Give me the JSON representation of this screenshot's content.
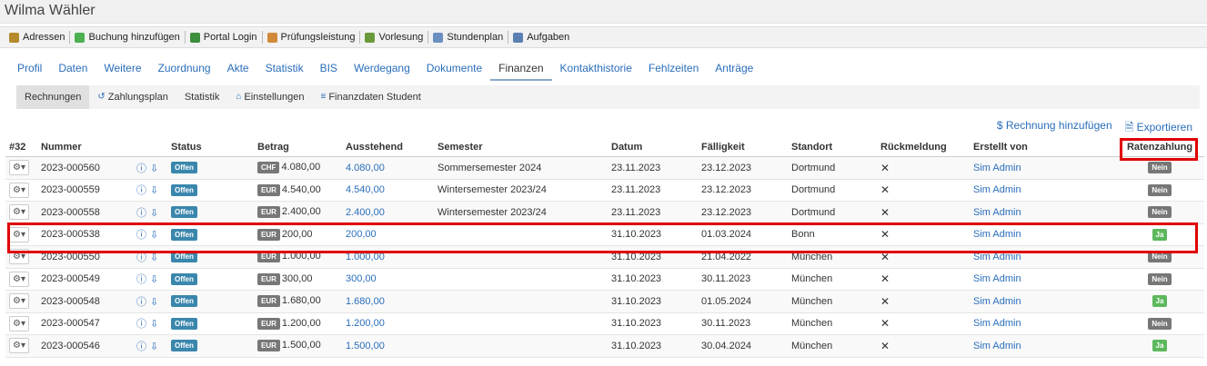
{
  "header": {
    "title": "Wilma Wähler"
  },
  "toolbar": {
    "items": [
      {
        "label": "Adressen",
        "icon": "address-book-icon",
        "color": "#b58a2a"
      },
      {
        "label": "Buchung hinzufügen",
        "icon": "add-booking-icon",
        "color": "#4caf50"
      },
      {
        "label": "Portal Login",
        "icon": "globe-icon",
        "color": "#3c8f3c"
      },
      {
        "label": "Prüfungsleistung",
        "icon": "exam-icon",
        "color": "#d08a3a"
      },
      {
        "label": "Vorlesung",
        "icon": "lecture-icon",
        "color": "#6a9a3a"
      },
      {
        "label": "Stundenplan",
        "icon": "calendar-icon",
        "color": "#6b8fc0"
      },
      {
        "label": "Aufgaben",
        "icon": "tasks-icon",
        "color": "#5b7fb0"
      }
    ]
  },
  "tabs": [
    {
      "label": "Profil"
    },
    {
      "label": "Daten"
    },
    {
      "label": "Weitere"
    },
    {
      "label": "Zuordnung"
    },
    {
      "label": "Akte"
    },
    {
      "label": "Statistik"
    },
    {
      "label": "BIS"
    },
    {
      "label": "Werdegang"
    },
    {
      "label": "Dokumente"
    },
    {
      "label": "Finanzen",
      "active": true
    },
    {
      "label": "Kontakthistorie"
    },
    {
      "label": "Fehlzeiten"
    },
    {
      "label": "Anträge"
    }
  ],
  "subtabs": [
    {
      "label": "Rechnungen",
      "icon": "",
      "active": true
    },
    {
      "label": "Zahlungsplan",
      "icon": "↺"
    },
    {
      "label": "Statistik",
      "icon": ""
    },
    {
      "label": "Einstellungen",
      "icon": "⌂"
    },
    {
      "label": "Finanzdaten Student",
      "icon": "≡"
    }
  ],
  "actions": {
    "add_invoice": "$ Rechnung hinzufügen",
    "export": "🗎 Exportieren"
  },
  "table": {
    "columns": [
      "#32",
      "Nummer",
      "",
      "Status",
      "Betrag",
      "Ausstehend",
      "Semester",
      "Datum",
      "Fälligkeit",
      "Standort",
      "Rückmeldung",
      "Erstellt von",
      "Ratenzahlung"
    ],
    "rows": [
      {
        "nummer": "2023-000560",
        "status": "Offen",
        "currency": "CHF",
        "betrag": "4.080,00",
        "ausstehend": "4.080,00",
        "semester": "Sommersemester 2024",
        "datum": "23.11.2023",
        "faelligkeit": "23.12.2023",
        "standort": "Dortmund",
        "rueckmeldung": "✕",
        "erstellt": "Sim Admin",
        "rate": "Nein"
      },
      {
        "nummer": "2023-000559",
        "status": "Offen",
        "currency": "EUR",
        "betrag": "4.540,00",
        "ausstehend": "4.540,00",
        "semester": "Wintersemester 2023/24",
        "datum": "23.11.2023",
        "faelligkeit": "23.12.2023",
        "standort": "Dortmund",
        "rueckmeldung": "✕",
        "erstellt": "Sim Admin",
        "rate": "Nein"
      },
      {
        "nummer": "2023-000558",
        "status": "Offen",
        "currency": "EUR",
        "betrag": "2.400,00",
        "ausstehend": "2.400,00",
        "semester": "Wintersemester 2023/24",
        "datum": "23.11.2023",
        "faelligkeit": "23.12.2023",
        "standort": "Dortmund",
        "rueckmeldung": "✕",
        "erstellt": "Sim Admin",
        "rate": "Nein"
      },
      {
        "nummer": "2023-000538",
        "status": "Offen",
        "currency": "EUR",
        "betrag": "200,00",
        "ausstehend": "200,00",
        "semester": "",
        "datum": "31.10.2023",
        "faelligkeit": "01.03.2024",
        "standort": "Bonn",
        "rueckmeldung": "✕",
        "erstellt": "Sim Admin",
        "rate": "Ja"
      },
      {
        "nummer": "2023-000550",
        "status": "Offen",
        "currency": "EUR",
        "betrag": "1.000,00",
        "ausstehend": "1.000,00",
        "semester": "",
        "datum": "31.10.2023",
        "faelligkeit": "21.04.2022",
        "standort": "München",
        "rueckmeldung": "✕",
        "erstellt": "Sim Admin",
        "rate": "Nein"
      },
      {
        "nummer": "2023-000549",
        "status": "Offen",
        "currency": "EUR",
        "betrag": "300,00",
        "ausstehend": "300,00",
        "semester": "",
        "datum": "31.10.2023",
        "faelligkeit": "30.11.2023",
        "standort": "München",
        "rueckmeldung": "✕",
        "erstellt": "Sim Admin",
        "rate": "Nein"
      },
      {
        "nummer": "2023-000548",
        "status": "Offen",
        "currency": "EUR",
        "betrag": "1.680,00",
        "ausstehend": "1.680,00",
        "semester": "",
        "datum": "31.10.2023",
        "faelligkeit": "01.05.2024",
        "standort": "München",
        "rueckmeldung": "✕",
        "erstellt": "Sim Admin",
        "rate": "Ja"
      },
      {
        "nummer": "2023-000547",
        "status": "Offen",
        "currency": "EUR",
        "betrag": "1.200,00",
        "ausstehend": "1.200,00",
        "semester": "",
        "datum": "31.10.2023",
        "faelligkeit": "30.11.2023",
        "standort": "München",
        "rueckmeldung": "✕",
        "erstellt": "Sim Admin",
        "rate": "Nein"
      },
      {
        "nummer": "2023-000546",
        "status": "Offen",
        "currency": "EUR",
        "betrag": "1.500,00",
        "ausstehend": "1.500,00",
        "semester": "",
        "datum": "31.10.2023",
        "faelligkeit": "30.04.2024",
        "standort": "München",
        "rueckmeldung": "✕",
        "erstellt": "Sim Admin",
        "rate": "Ja"
      }
    ]
  },
  "colors": {
    "link": "#2a6ebb",
    "highlight": "#e00000",
    "offen": "#3a87ad",
    "ja": "#5cb85c",
    "nein": "#777777"
  }
}
